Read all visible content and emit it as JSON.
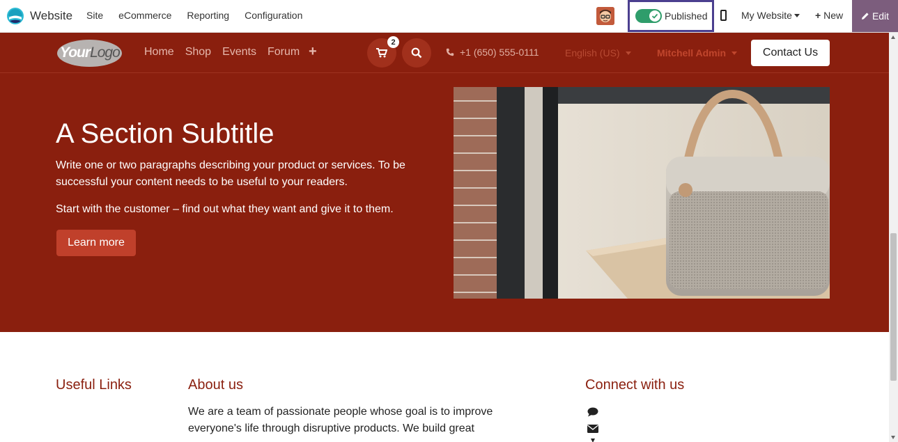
{
  "topbar": {
    "app_name": "Website",
    "menu": [
      "Site",
      "eCommerce",
      "Reporting",
      "Configuration"
    ],
    "publish_label": "Published",
    "my_website_label": "My Website",
    "new_label": "New",
    "edit_label": "Edit"
  },
  "site_header": {
    "logo_text_1": "Your",
    "logo_text_2": "Logo",
    "nav": [
      "Home",
      "Shop",
      "Events",
      "Forum"
    ],
    "cart_count": "2",
    "phone": "+1 (650) 555-0111",
    "language": "English (US)",
    "user": "Mitchell Admin",
    "contact_label": "Contact Us"
  },
  "hero": {
    "title": "A Section Subtitle",
    "paragraph_1": "Write one or two paragraphs describing your product or services. To be successful your content needs to be useful to your readers.",
    "paragraph_2": "Start with the customer – find out what they want and give it to them.",
    "button_label": "Learn more"
  },
  "footer": {
    "useful_links_title": "Useful Links",
    "about_title": "About us",
    "about_text": "We are a team of passionate people whose goal is to improve everyone's life through disruptive products. We build great",
    "connect_title": "Connect with us"
  },
  "colors": {
    "brand": "#8a1f0e",
    "accent": "#c0402b",
    "publish_toggle": "#2f9d6b",
    "edit_button": "#7c5d7d"
  }
}
